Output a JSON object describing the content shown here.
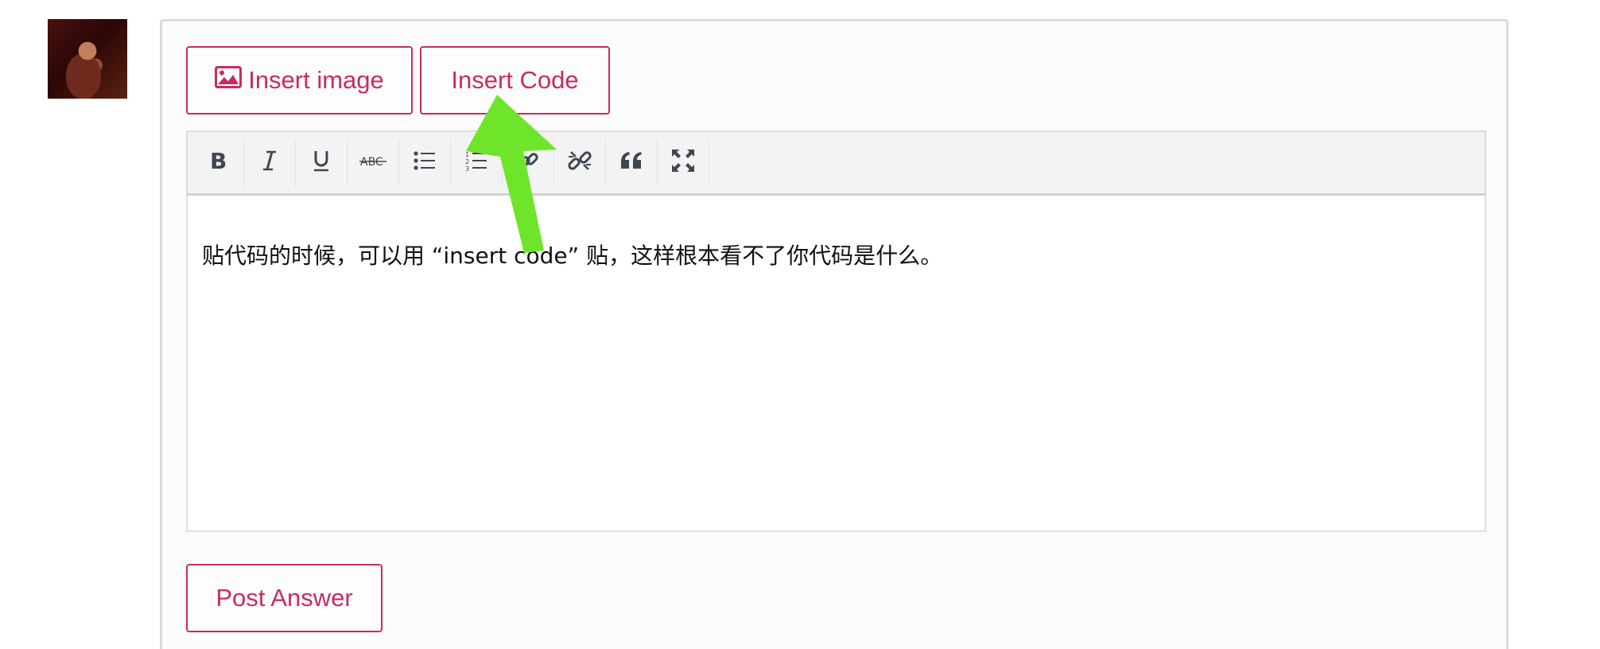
{
  "buttons": {
    "insert_image": "Insert image",
    "insert_code": "Insert Code",
    "post_answer": "Post Answer"
  },
  "toolbar": {
    "items": [
      "bold",
      "italic",
      "underline",
      "strikethrough",
      "bulleted-list",
      "numbered-list",
      "link",
      "unlink",
      "blockquote",
      "fullscreen"
    ],
    "strikethrough_label": "ABC"
  },
  "editor": {
    "content": "贴代码的时候，可以用 “insert code” 贴，这样根本看不了你代码是什么。"
  },
  "colors": {
    "accent": "#c82b63",
    "annotation_arrow": "#6ee52a",
    "icon": "#3f4752",
    "toolbar_bg": "#f3f3f3"
  }
}
